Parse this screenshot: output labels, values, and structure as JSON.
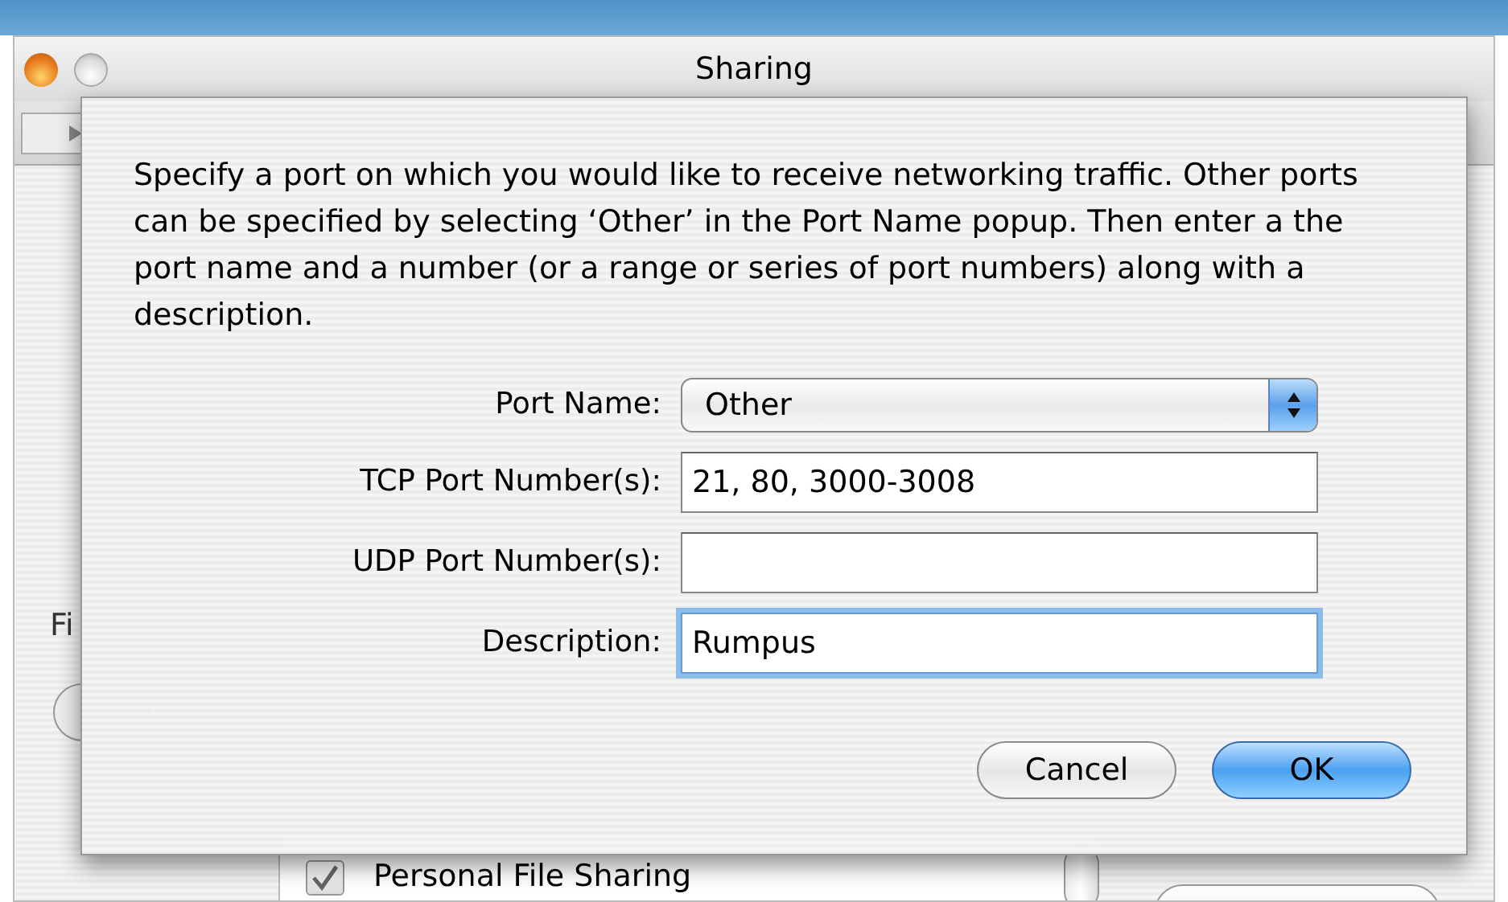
{
  "window": {
    "title": "Sharing"
  },
  "background": {
    "firewall_label": "Fi",
    "list_rows": [
      {
        "label": "Personal File Sharing",
        "checked": true
      }
    ]
  },
  "sheet": {
    "message": "Specify a port on which you would like to receive networking traffic. Other ports can be specified by selecting ‘Other’ in the Port Name popup. Then enter a the port name and a number (or a range or series of port numbers) along with a description.",
    "fields": [
      {
        "kind": "popup",
        "label": "Port Name:",
        "value": "Other"
      },
      {
        "kind": "text",
        "label": "TCP Port Number(s):",
        "value": "21, 80, 3000-3008",
        "focused": false
      },
      {
        "kind": "text",
        "label": "UDP Port Number(s):",
        "focused": false
      },
      {
        "kind": "text",
        "label": "Description:",
        "value": "Rumpus",
        "focused": true
      }
    ],
    "buttons": [
      {
        "label": "Cancel",
        "default": false
      },
      {
        "label": "OK",
        "default": true
      }
    ]
  }
}
